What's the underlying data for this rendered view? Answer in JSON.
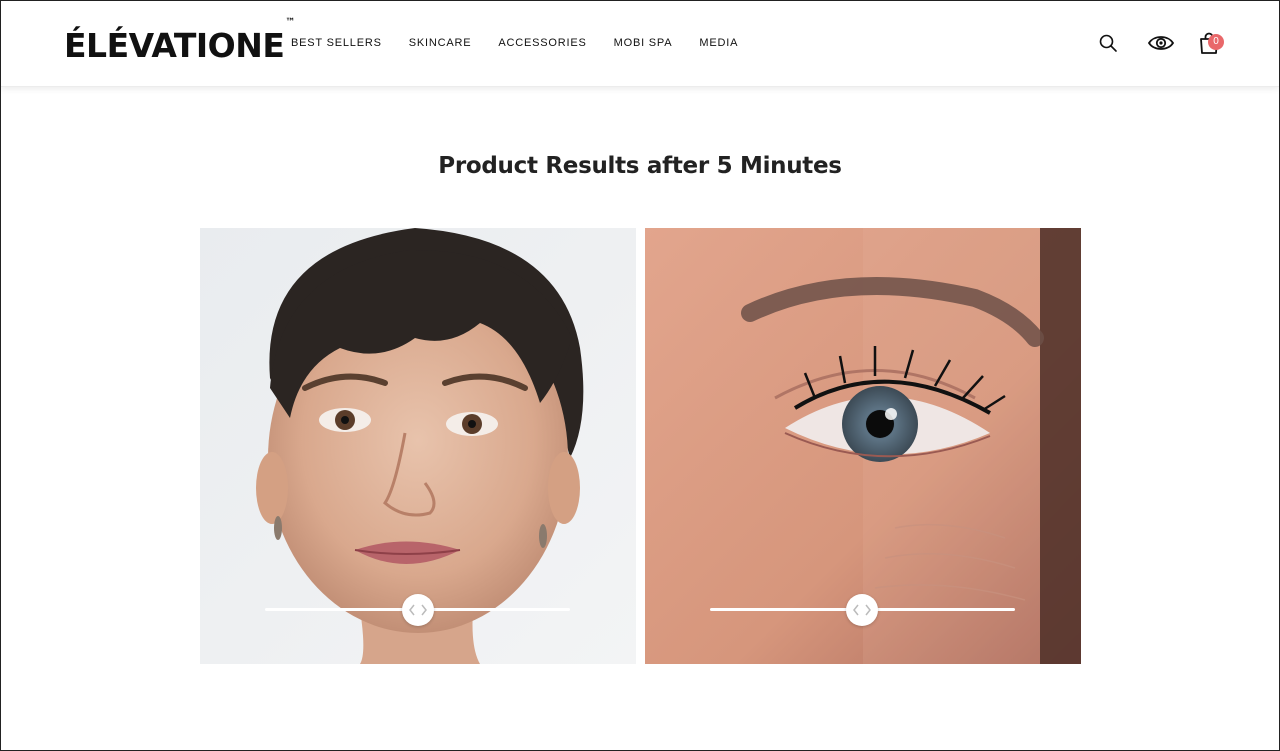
{
  "brand": {
    "name": "ÉLÉVATIONE",
    "trademark": "™"
  },
  "nav": {
    "items": [
      "BEST SELLERS",
      "SKINCARE",
      "ACCESSORIES",
      "MOBI SPA",
      "MEDIA"
    ]
  },
  "header_icons": {
    "search": "search-icon",
    "eye": "eye-icon",
    "cart": "shopping-bag-icon",
    "cart_count": "0",
    "badge_color": "#e9686a"
  },
  "results": {
    "title": "Product Results after 5 Minutes",
    "comparisons": [
      {
        "subject": "face before-after comparison",
        "slider_position": 0.5
      },
      {
        "subject": "eye before-after comparison",
        "slider_position": 0.5
      }
    ]
  }
}
